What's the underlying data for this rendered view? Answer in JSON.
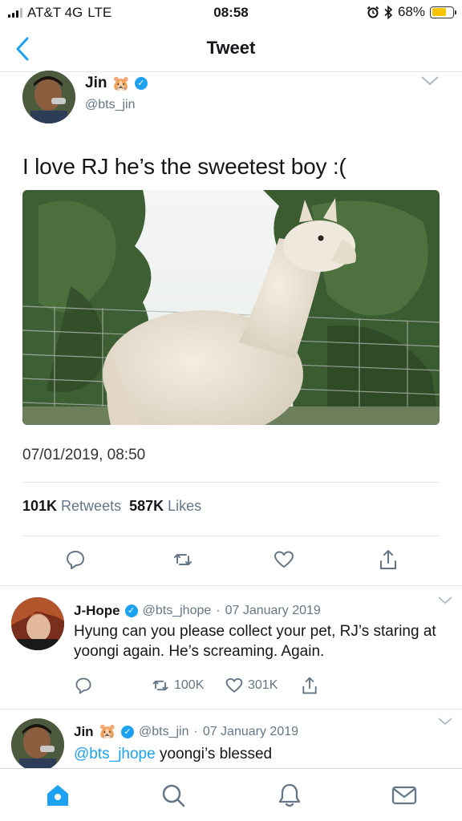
{
  "status_bar": {
    "carrier": "AT&T 4G",
    "network": "LTE",
    "time": "08:58",
    "battery": "68%",
    "battery_level": 0.68,
    "battery_color": "#f7c500"
  },
  "nav": {
    "title": "Tweet",
    "back_icon": "chevron-left-icon"
  },
  "tweet": {
    "author": {
      "name": "Jin",
      "emoji": "🐹",
      "handle": "@bts_jin",
      "verified": true
    },
    "text": "I love RJ he’s the sweetest boy :(",
    "timestamp": "07/01/2019, 08:50",
    "retweet_count": "101K",
    "retweet_label": "Retweets",
    "like_count": "587K",
    "like_label": "Likes",
    "actions": [
      "reply-icon",
      "retweet-icon",
      "heart-icon",
      "share-icon"
    ]
  },
  "replies": [
    {
      "name": "J-Hope",
      "handle": "@bts_jhope",
      "date": "07 January 2019",
      "text": "Hyung can you please collect your pet, RJ’s staring at yoongi again. He’s screaming. Again.",
      "retweets": "100K",
      "likes": "301K"
    },
    {
      "name": "Jin",
      "emoji": "🐹",
      "handle": "@bts_jin",
      "date": "07 January 2019",
      "mention": "@bts_jhope",
      "text": "yoongi’s blessed"
    }
  ],
  "tab_bar": {
    "items": [
      "home-icon",
      "search-icon",
      "notifications-icon",
      "messages-icon"
    ],
    "active_color": "#1da1f2"
  },
  "colors": {
    "accent": "#1da1f2",
    "secondary_text": "#657786",
    "divider": "#e1e8ed"
  }
}
